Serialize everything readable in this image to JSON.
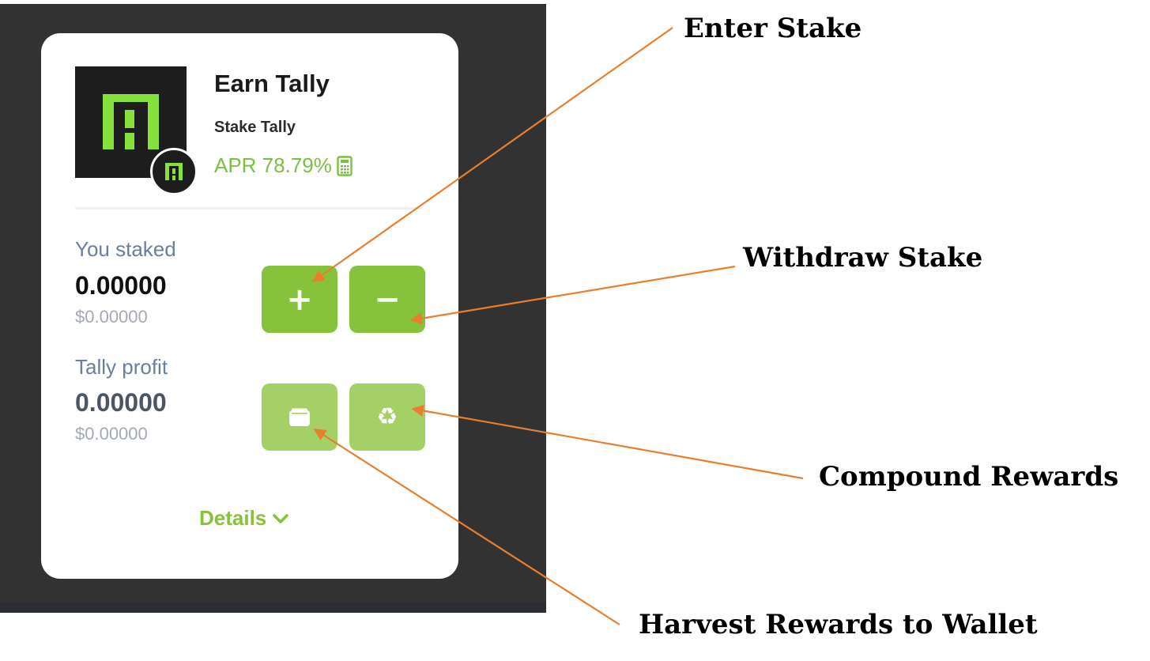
{
  "pool": {
    "title": "Earn Tally",
    "subtitle": "Stake Tally",
    "apr": "APR 78.79%"
  },
  "staked": {
    "label": "You staked",
    "value": "0.00000",
    "usd": "$0.00000"
  },
  "profit": {
    "label": "Tally profit",
    "value": "0.00000",
    "usd": "$0.00000"
  },
  "buttons": {
    "plus": "+",
    "minus": "−"
  },
  "details": {
    "label": "Details"
  },
  "annotations": {
    "enter_stake": "Enter Stake",
    "withdraw_stake": "Withdraw Stake",
    "compound_rewards": "Compound Rewards",
    "harvest_rewards": "Harvest Rewards to Wallet"
  },
  "icons": {
    "logo": "tally-logo-icon",
    "badge": "tally-badge-icon",
    "apr": "calculator-icon",
    "harvest": "wallet-icon",
    "compound": "recycle-icon",
    "details": "chevron-down-icon"
  },
  "colors": {
    "accent": "#86c23b",
    "accent_light": "#a4d066",
    "apr_green": "#7ac142",
    "annotation_line": "#e87f2f",
    "dark_bg": "#323232"
  }
}
